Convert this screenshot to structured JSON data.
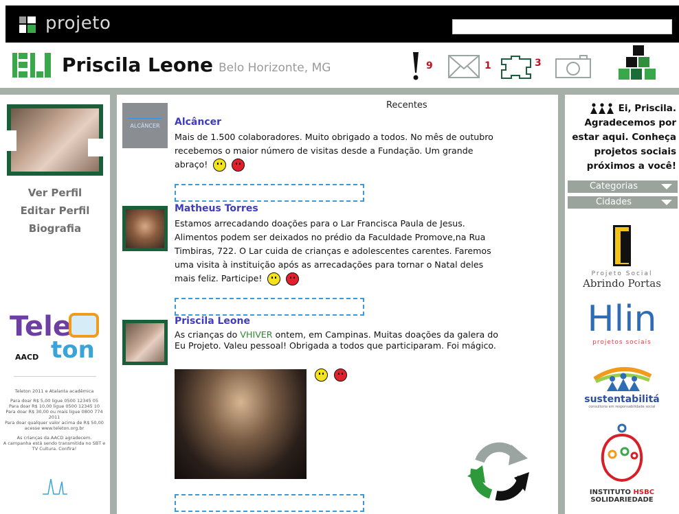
{
  "topbar": {
    "brand": "projeto",
    "search_value": ""
  },
  "header": {
    "eu_logo": "EU",
    "name": "Priscila Leone",
    "location": "Belo Horizonte, MG",
    "alerts_count": "9",
    "messages_count": "1",
    "puzzle_count": "3"
  },
  "left": {
    "links": [
      "Ver Perfil",
      "Editar Perfil",
      "Biografia"
    ],
    "teleton": {
      "brand_top": "Tele",
      "brand_bottom": "ton",
      "aacd": "AACD",
      "lines": [
        "Teleton 2011 e Atalanta acadêmica",
        "Para doar R$ 5,00 ligue 0500 12345 05",
        "Para doar R$ 10,00 ligue 0500 12345 10",
        "Para doar R$ 30,00 ou mais ligue 0800 774 2011",
        "Para doar qualquer valor acima de R$ 50,00 acesse www.teleton.org.br",
        "As crianças da AACD agradecem.",
        "A campanha está sendo transmitida no SBT e TV Cultura. Confira!"
      ]
    }
  },
  "feed": {
    "title": "Recentes",
    "posts": [
      {
        "author": "Alcâncer",
        "avatar_text": "ALCÂNCER",
        "body": "Mais de 1.500 colaboradores. Muito obrigado a todos. No mês de outubro recebemos o maior número de visitas desde a Fundação. Um grande abraço!"
      },
      {
        "author": "Matheus Torres",
        "body": "Estamos arrecadando doações para o Lar Francisca Paula de Jesus. Alimentos podem ser deixados no prédio da Faculdade Promove,na Rua Timbiras, 722. O Lar cuida de crianças e adolescentes carentes. Faremos uma visita à instituição após as arrecadações para tornar o Natal deles mais feliz. Participe!"
      },
      {
        "author": "Priscila Leone",
        "body_before": "As crianças do ",
        "body_highlight": "VHIVER",
        "body_after": " ontem, em Campinas. Muitas doações da galera do Eu Projeto. Valeu pessoal! Obrigada a todos que participaram. Foi mágico."
      }
    ]
  },
  "right": {
    "greeting": "Ei, Priscila. Agradecemos por estar aqui. Conheça projetos sociais próximos a você!",
    "categories_label": "Categorias",
    "cities_label": "Cidades",
    "partners": {
      "abrindo_small": "Projeto Social",
      "abrindo_big": "Abrindo Portas",
      "hlin_big": "Hlin",
      "hlin_small": "projetos sociais",
      "sust_big": "sustentabilitá",
      "sust_small": "consultoria em responsabilidade social",
      "hsbc_line1_a": "INSTITUTO",
      "hsbc_line1_b": "HSBC",
      "hsbc_line2": "SOLIDARIEDADE"
    }
  },
  "colors": {
    "brand_green": "#19603a",
    "divider_gray": "#a7b0a8",
    "author_blue": "#3f3cbe",
    "badge_red": "#c1121f"
  }
}
